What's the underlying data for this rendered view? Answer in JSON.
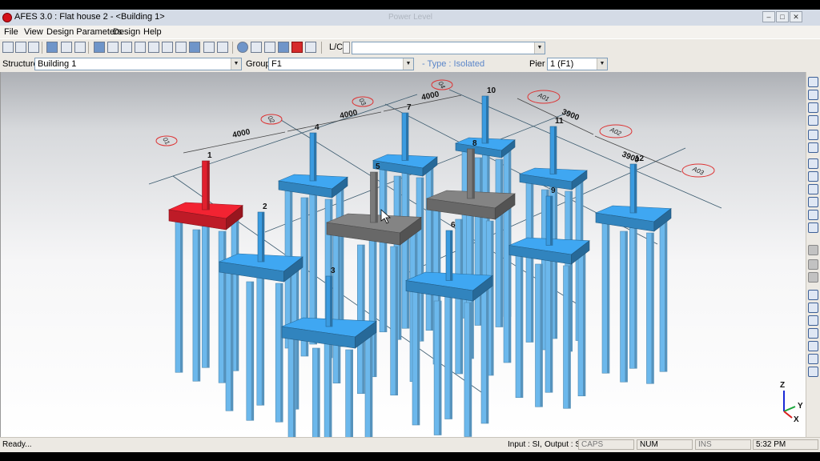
{
  "window": {
    "title": "AFES 3.0 : Flat house 2 - <Building 1>",
    "faded_title": "Power   Level",
    "minimize": "‒",
    "maximize": "□",
    "close": "✕"
  },
  "menu": [
    "File",
    "View",
    "Design Parameters",
    "Design",
    "Help"
  ],
  "toolbar": {
    "lc_label": "L/C",
    "lc_value": ""
  },
  "selection": {
    "structure_label": "Structure",
    "structure_value": "Building 1",
    "group_label": "Group",
    "group_value": "F1",
    "type_text": "- Type : Isolated",
    "pier_label": "Pier",
    "pier_value": "1 (F1)"
  },
  "model": {
    "dimensions_x": [
      "4000",
      "4000",
      "4000"
    ],
    "dimensions_y": [
      "3900",
      "3900"
    ],
    "grid_x": [
      "01",
      "02",
      "03",
      "04"
    ],
    "grid_y": [
      "A01",
      "A02",
      "A03"
    ],
    "footings": [
      "1",
      "2",
      "3",
      "4",
      "5",
      "6",
      "7",
      "8",
      "9",
      "10",
      "11",
      "12"
    ],
    "axes": {
      "x": "X",
      "y": "Y",
      "z": "Z"
    },
    "colors": {
      "footing": "#3a9be0",
      "pile": "#6cb8ec",
      "selected": "#e0202e",
      "highlighted": "#7a7a7a",
      "grid": "#3a5a6e",
      "bubble": "#d33"
    }
  },
  "status": {
    "ready": "Ready...",
    "input": "Input : SI,",
    "output": "Output : SI",
    "caps": "CAPS",
    "num": "NUM",
    "ins": "INS",
    "time": "5:32 PM"
  }
}
